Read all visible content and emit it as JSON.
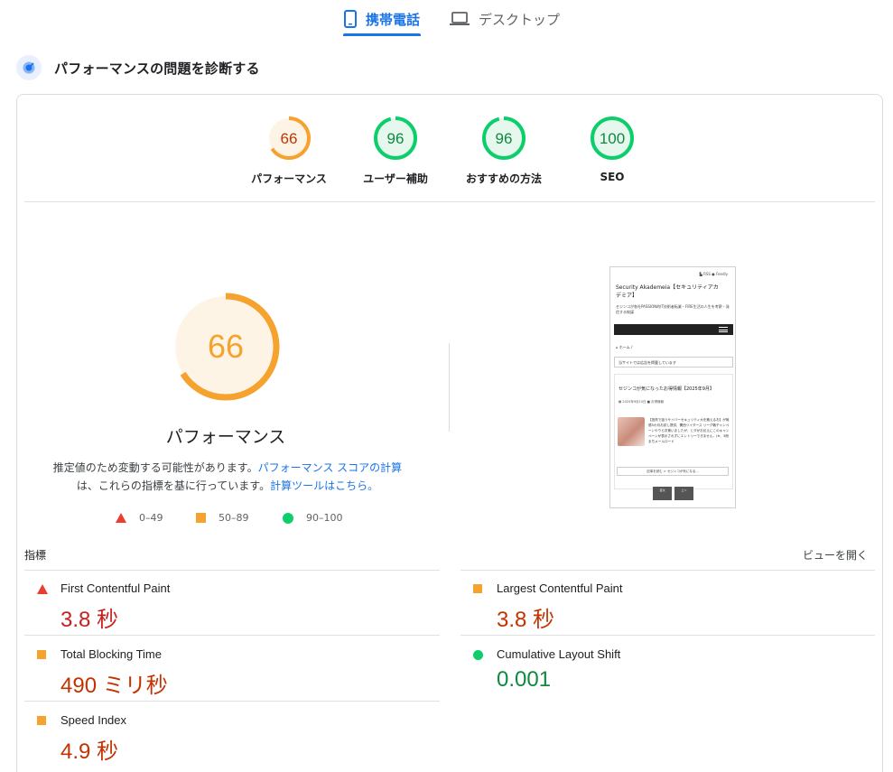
{
  "tabs": {
    "mobile": "携帯電話",
    "desktop": "デスクトップ"
  },
  "section": {
    "title": "パフォーマンスの問題を診断する"
  },
  "gauges": [
    {
      "score": "66",
      "label": "パフォーマンス",
      "value": 66,
      "color": "#f5a22e"
    },
    {
      "score": "96",
      "label": "ユーザー補助",
      "value": 96,
      "color": "#0cce6b"
    },
    {
      "score": "96",
      "label": "おすすめの方法",
      "value": 96,
      "color": "#0cce6b"
    },
    {
      "score": "100",
      "label": "SEO",
      "value": 100,
      "color": "#0cce6b"
    }
  ],
  "main_gauge": {
    "score": "66",
    "title": "パフォーマンス",
    "explain_1": "推定値のため変動する可能性があります。",
    "explain_link_1": "パフォーマンス スコアの計算",
    "explain_2": "は、これらの指標を基に行っています。",
    "explain_link_2": "計算ツールはこちら。"
  },
  "legend": {
    "fail": "0–49",
    "average": "50–89",
    "pass": "90–100"
  },
  "thumbnail": {
    "top_links": "▙ RSS   ● Feedly",
    "site_title": "Security Akademeia【セキュリティアカデミア】",
    "subtitle": "セジンコが各社PASSION的IT技術者転業・FIRE生活の人生を考察・発信する純媒",
    "breadcrumb": "⌂ ホーム /",
    "select_text": "当サイトでは広告を掲載しています",
    "post_title": "セジンコが気になったお得情報【2025年9月】",
    "post_date": "▦ 2025年9月15日   ■ お得情報",
    "post_excerpt": "【投資で狙うサイバーセキュリティ大を鍛えるお】が無償5か月お試し提供、関西ツイダース リーグ戦チャンペーンやウら次第いましたが、とダがお伝えにこのキャンペーンが表示されずにエントリーできません。(※、3冊まちメールロード",
    "post_button": "記事を読む > セジンコが気になる...",
    "foot_1": "目次",
    "foot_2": "上へ"
  },
  "metrics": {
    "label": "指標",
    "expand": "ビューを開く",
    "items": [
      {
        "name": "First Contentful Paint",
        "value": "3.8 秒",
        "status": "fail"
      },
      {
        "name": "Largest Contentful Paint",
        "value": "3.8 秒",
        "status": "average"
      },
      {
        "name": "Total Blocking Time",
        "value": "490 ミリ秒",
        "status": "average"
      },
      {
        "name": "Cumulative Layout Shift",
        "value": "0.001",
        "status": "pass"
      },
      {
        "name": "Speed Index",
        "value": "4.9 秒",
        "status": "average"
      }
    ]
  },
  "colors": {
    "accent": "#1a73e8",
    "fail": "#eb3c30",
    "average": "#f5a22e",
    "pass": "#0cce6b"
  }
}
